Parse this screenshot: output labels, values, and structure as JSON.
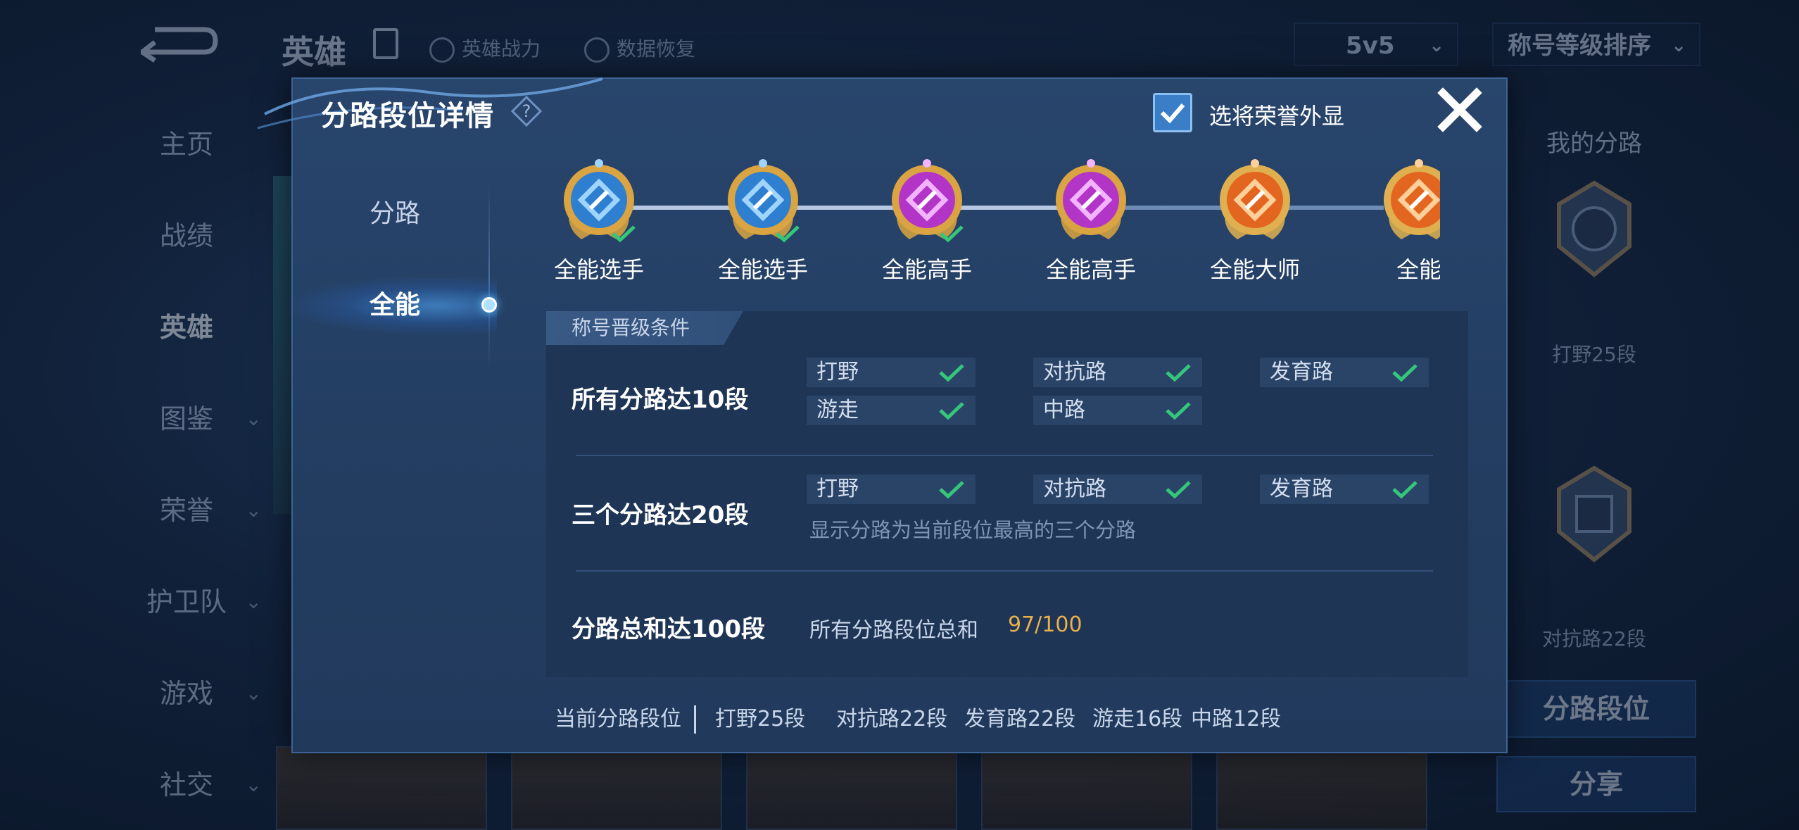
{
  "background": {
    "top_title": "英雄",
    "top_links": [
      "英雄战力",
      "数据恢复"
    ],
    "mode_select": "5v5",
    "sort_select": "称号等级排序",
    "side_nav": [
      {
        "label": "主页"
      },
      {
        "label": "战绩"
      },
      {
        "label": "英雄",
        "active": true
      },
      {
        "label": "图鉴"
      },
      {
        "label": "荣誉"
      },
      {
        "label": "护卫队"
      },
      {
        "label": "游戏"
      },
      {
        "label": "社交"
      }
    ],
    "right_panel": {
      "title": "我的分路",
      "items": [
        "打野25段",
        "对抗路22段"
      ],
      "lane_button": "分路段位",
      "share_button": "分享"
    }
  },
  "modal": {
    "title": "分路段位详情",
    "show_honor_label": "选将荣誉外显",
    "show_honor_checked": true,
    "tabs": [
      "分路",
      "全能"
    ],
    "active_tab": "全能",
    "ranks": [
      {
        "label": "全能选手",
        "tier": "gold-blue",
        "achieved": true
      },
      {
        "label": "全能选手",
        "tier": "gold-blue",
        "achieved": true
      },
      {
        "label": "全能高手",
        "tier": "purple",
        "achieved": true
      },
      {
        "label": "全能高手",
        "tier": "purple",
        "achieved": false
      },
      {
        "label": "全能大师",
        "tier": "orange",
        "achieved": false
      },
      {
        "label": "全能",
        "tier": "orange",
        "achieved": false
      }
    ],
    "conditions_header": "称号晋级条件",
    "conditions": {
      "row1": {
        "title": "所有分路达10段",
        "lanes": [
          "打野",
          "对抗路",
          "发育路",
          "游走",
          "中路"
        ]
      },
      "row2": {
        "title": "三个分路达20段",
        "lanes": [
          "打野",
          "对抗路",
          "发育路"
        ],
        "note": "显示分路为当前段位最高的三个分路"
      },
      "row3": {
        "title": "分路总和达100段",
        "sum_label": "所有分路段位总和",
        "sum_value": "97/100"
      }
    },
    "footer": {
      "title": "当前分路段位",
      "items": [
        "打野25段",
        "对抗路22段",
        "发育路22段",
        "游走16段",
        "中路12段"
      ]
    }
  },
  "colors": {
    "accent_check": "#34c77b",
    "sum_value": "#e8b04e",
    "modal_bg": "#28456c"
  }
}
